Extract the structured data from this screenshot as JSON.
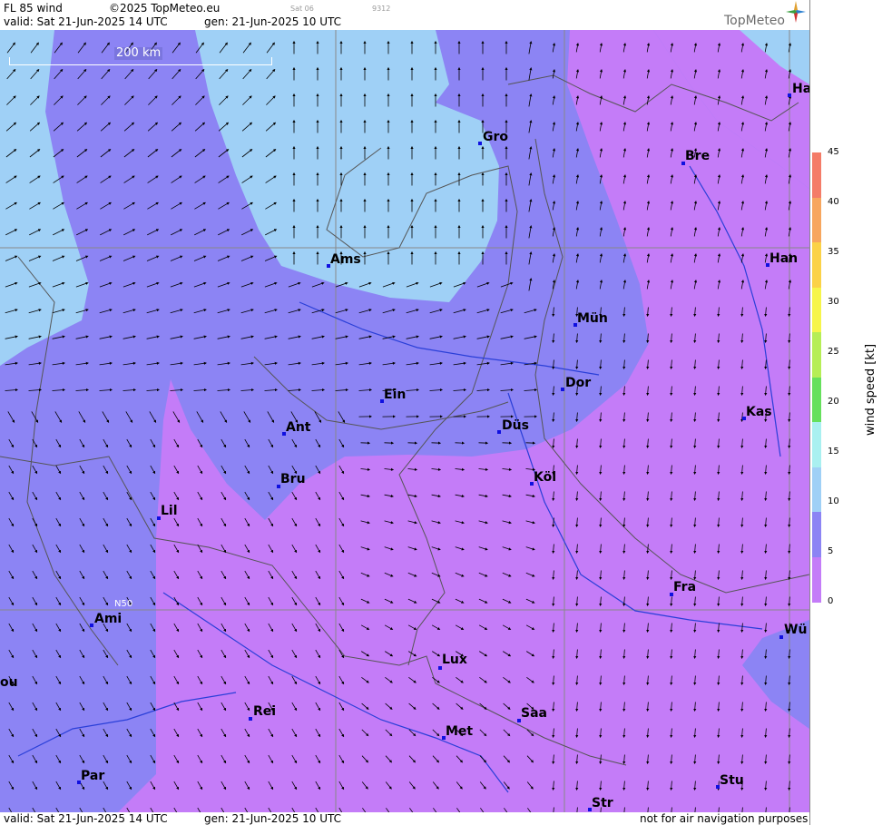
{
  "header": {
    "product": "FL 85 wind",
    "copyright": "©2025 TopMeteo.eu",
    "sat_tag": "Sat 06",
    "code": "9312",
    "valid": "valid:  Sat  21-Jun-2025  14 UTC",
    "gen": "gen:  21-Jun-2025 10 UTC",
    "brand": "TopMeteo"
  },
  "footer": {
    "valid": "valid:  Sat  21-Jun-2025  14 UTC",
    "gen": "gen:  21-Jun-2025 10 UTC",
    "disclaimer": "not for air navigation purposes"
  },
  "map": {
    "scale_label": "200 km",
    "lat_label": "N50",
    "cities": [
      {
        "name": "Ha"
      },
      {
        "name": "Gro"
      },
      {
        "name": "Bre"
      },
      {
        "name": "Ams"
      },
      {
        "name": "Han"
      },
      {
        "name": "Mün"
      },
      {
        "name": "Ein"
      },
      {
        "name": "Dor"
      },
      {
        "name": "Kas"
      },
      {
        "name": "Ant"
      },
      {
        "name": "Düs"
      },
      {
        "name": "Köl"
      },
      {
        "name": "Bru"
      },
      {
        "name": "Lil"
      },
      {
        "name": "Fra"
      },
      {
        "name": "Ami"
      },
      {
        "name": "Wü"
      },
      {
        "name": "ou"
      },
      {
        "name": "Lux"
      },
      {
        "name": "Rei"
      },
      {
        "name": "Saa"
      },
      {
        "name": "Met"
      },
      {
        "name": "Par"
      },
      {
        "name": "Stu"
      },
      {
        "name": "Str"
      }
    ]
  },
  "colorbar": {
    "title": "wind  speed  [kt]",
    "ticks": [
      "45",
      "40",
      "35",
      "30",
      "25",
      "20",
      "15",
      "10",
      "5",
      "0"
    ],
    "colors": [
      "#f47c68",
      "#f7a65e",
      "#fbd247",
      "#f6f54a",
      "#b6ee56",
      "#66e05c",
      "#a9f0f0",
      "#9fd0f6",
      "#8c84f4",
      "#c47cf8"
    ]
  }
}
